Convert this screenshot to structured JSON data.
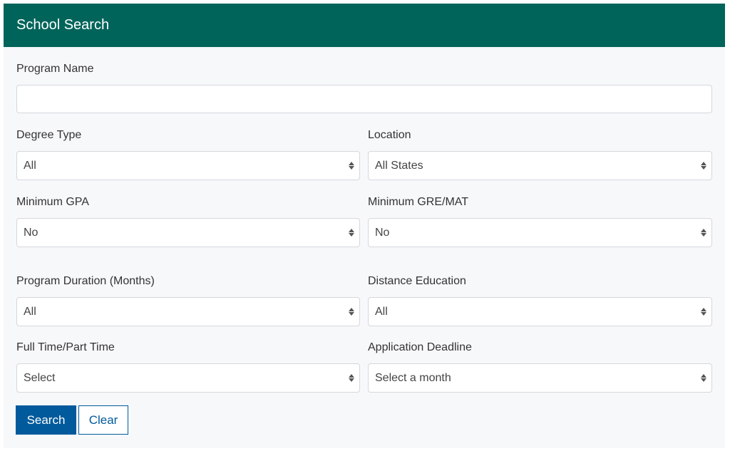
{
  "panel": {
    "title": "School Search",
    "header_color": "#00645a"
  },
  "fields": {
    "program_name": {
      "label": "Program Name",
      "value": "",
      "placeholder": ""
    },
    "degree_type": {
      "label": "Degree Type",
      "value": "All"
    },
    "location": {
      "label": "Location",
      "value": "All States"
    },
    "minimum_gpa": {
      "label": "Minimum GPA",
      "value": "No"
    },
    "minimum_gre_mat": {
      "label": "Minimum GRE/MAT",
      "value": "No"
    },
    "program_duration": {
      "label": "Program Duration (Months)",
      "value": "All"
    },
    "distance_education": {
      "label": "Distance Education",
      "value": "All"
    },
    "full_part_time": {
      "label": "Full Time/Part Time",
      "value": "Select"
    },
    "application_deadline": {
      "label": "Application Deadline",
      "value": "Select a month"
    }
  },
  "actions": {
    "search_label": "Search",
    "clear_label": "Clear",
    "primary_color": "#005a9c"
  },
  "icons": {
    "select_arrows": "up-down-arrows-icon"
  }
}
